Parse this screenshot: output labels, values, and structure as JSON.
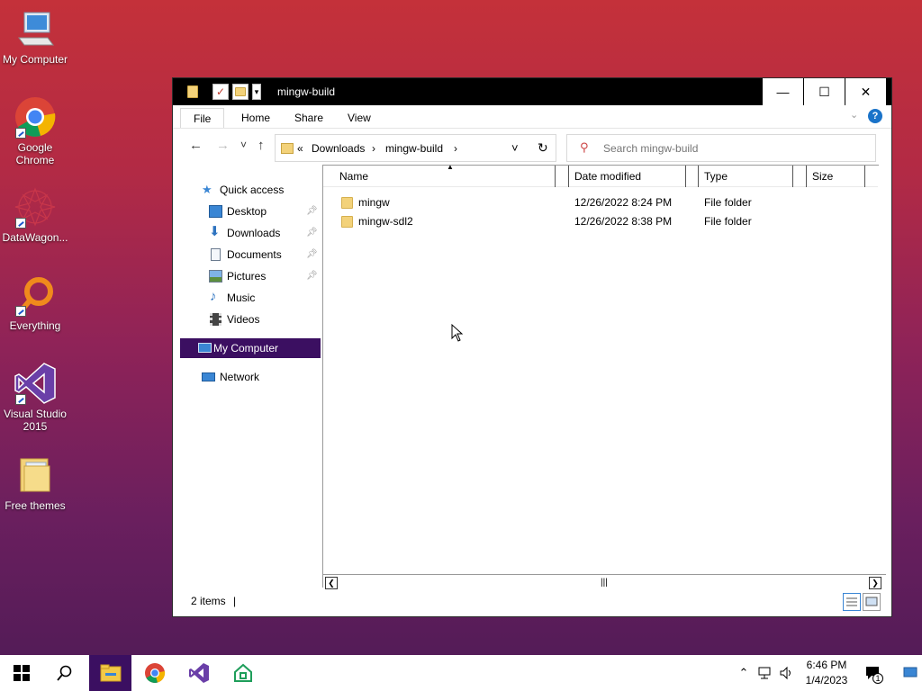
{
  "desktop": {
    "icons": [
      {
        "label": "My Computer"
      },
      {
        "label": "Google Chrome"
      },
      {
        "label": "DataWagon..."
      },
      {
        "label": "Everything"
      },
      {
        "label": "Visual Studio 2015"
      },
      {
        "label": "Free themes"
      }
    ]
  },
  "window": {
    "title": "mingw-build",
    "controls": {
      "minimize": "—",
      "maximize": "☐",
      "close": "✕"
    }
  },
  "ribbon": {
    "tabs": [
      "File",
      "Home",
      "Share",
      "View"
    ],
    "help": "?"
  },
  "nav": {
    "back": "←",
    "forward": "→",
    "recent": "˅",
    "up": "↑",
    "address": {
      "prefix": "«",
      "crumbs": [
        "Downloads",
        "mingw-build"
      ],
      "sep": "›",
      "refresh": "↻",
      "dropdown": "˅"
    },
    "search": {
      "placeholder": "Search mingw-build"
    }
  },
  "navpane": {
    "quick_access": "Quick access",
    "items": [
      {
        "label": "Desktop",
        "pinned": true
      },
      {
        "label": "Downloads",
        "pinned": true
      },
      {
        "label": "Documents",
        "pinned": true
      },
      {
        "label": "Pictures",
        "pinned": true
      },
      {
        "label": "Music",
        "pinned": false
      },
      {
        "label": "Videos",
        "pinned": false
      }
    ],
    "my_computer": "My Computer",
    "network": "Network"
  },
  "filelist": {
    "columns": [
      "Name",
      "Date modified",
      "Type",
      "Size"
    ],
    "rows": [
      {
        "name": "mingw",
        "date": "12/26/2022 8:24 PM",
        "type": "File folder",
        "size": ""
      },
      {
        "name": "mingw-sdl2",
        "date": "12/26/2022 8:38 PM",
        "type": "File folder",
        "size": ""
      }
    ]
  },
  "status": {
    "items": "2 items"
  },
  "taskbar": {
    "clock_time": "6:46 PM",
    "clock_date": "1/4/2023",
    "notifications": "1"
  },
  "colors": {
    "selection": "#3b0f61",
    "accent": "#1a73c9"
  }
}
